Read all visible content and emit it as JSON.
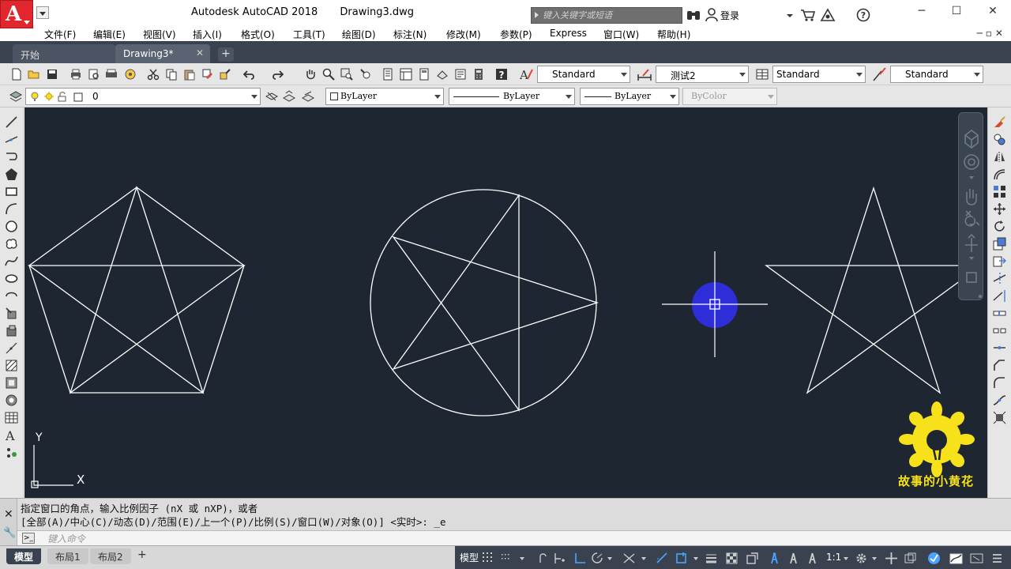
{
  "titlebar": {
    "app_name": "Autodesk AutoCAD 2018",
    "doc_name": "Drawing3.dwg",
    "search_placeholder": "键入关键字或短语",
    "login": "登录"
  },
  "menu": {
    "items": [
      "文件(F)",
      "编辑(E)",
      "视图(V)",
      "插入(I)",
      "格式(O)",
      "工具(T)",
      "绘图(D)",
      "标注(N)",
      "修改(M)",
      "参数(P)",
      "Express",
      "窗口(W)",
      "帮助(H)"
    ]
  },
  "file_tabs": {
    "start": "开始",
    "drawing": "Drawing3*",
    "close_glyph": "✕",
    "add_glyph": "+"
  },
  "styles": {
    "text_style": "Standard",
    "dim_style": "测试2",
    "table_style": "Standard",
    "multileader_style": "Standard"
  },
  "layers": {
    "current_layer": "0",
    "color": "ByLayer",
    "linetype": "ByLayer",
    "lineweight": "ByLayer",
    "plot_style": "ByColor"
  },
  "canvas": {
    "ucs_y": "Y",
    "ucs_x": "X",
    "watermark_text": "故事的小黄花",
    "background": "#1d2631",
    "line_color": "#ffffff",
    "cursor_highlight": "#2d2ed8"
  },
  "command": {
    "line1": "指定窗口的角点，输入比例因子 (nX 或 nXP)，或者",
    "line2": "[全部(A)/中心(C)/动态(D)/范围(E)/上一个(P)/比例(S)/窗口(W)/对象(O)] <实时>: _e",
    "input_placeholder": "键入命令"
  },
  "status": {
    "model_tab": "模型",
    "layout1": "布局1",
    "layout2": "布局2",
    "add_glyph": "+",
    "model_label": "模型",
    "scale": "1:1"
  }
}
